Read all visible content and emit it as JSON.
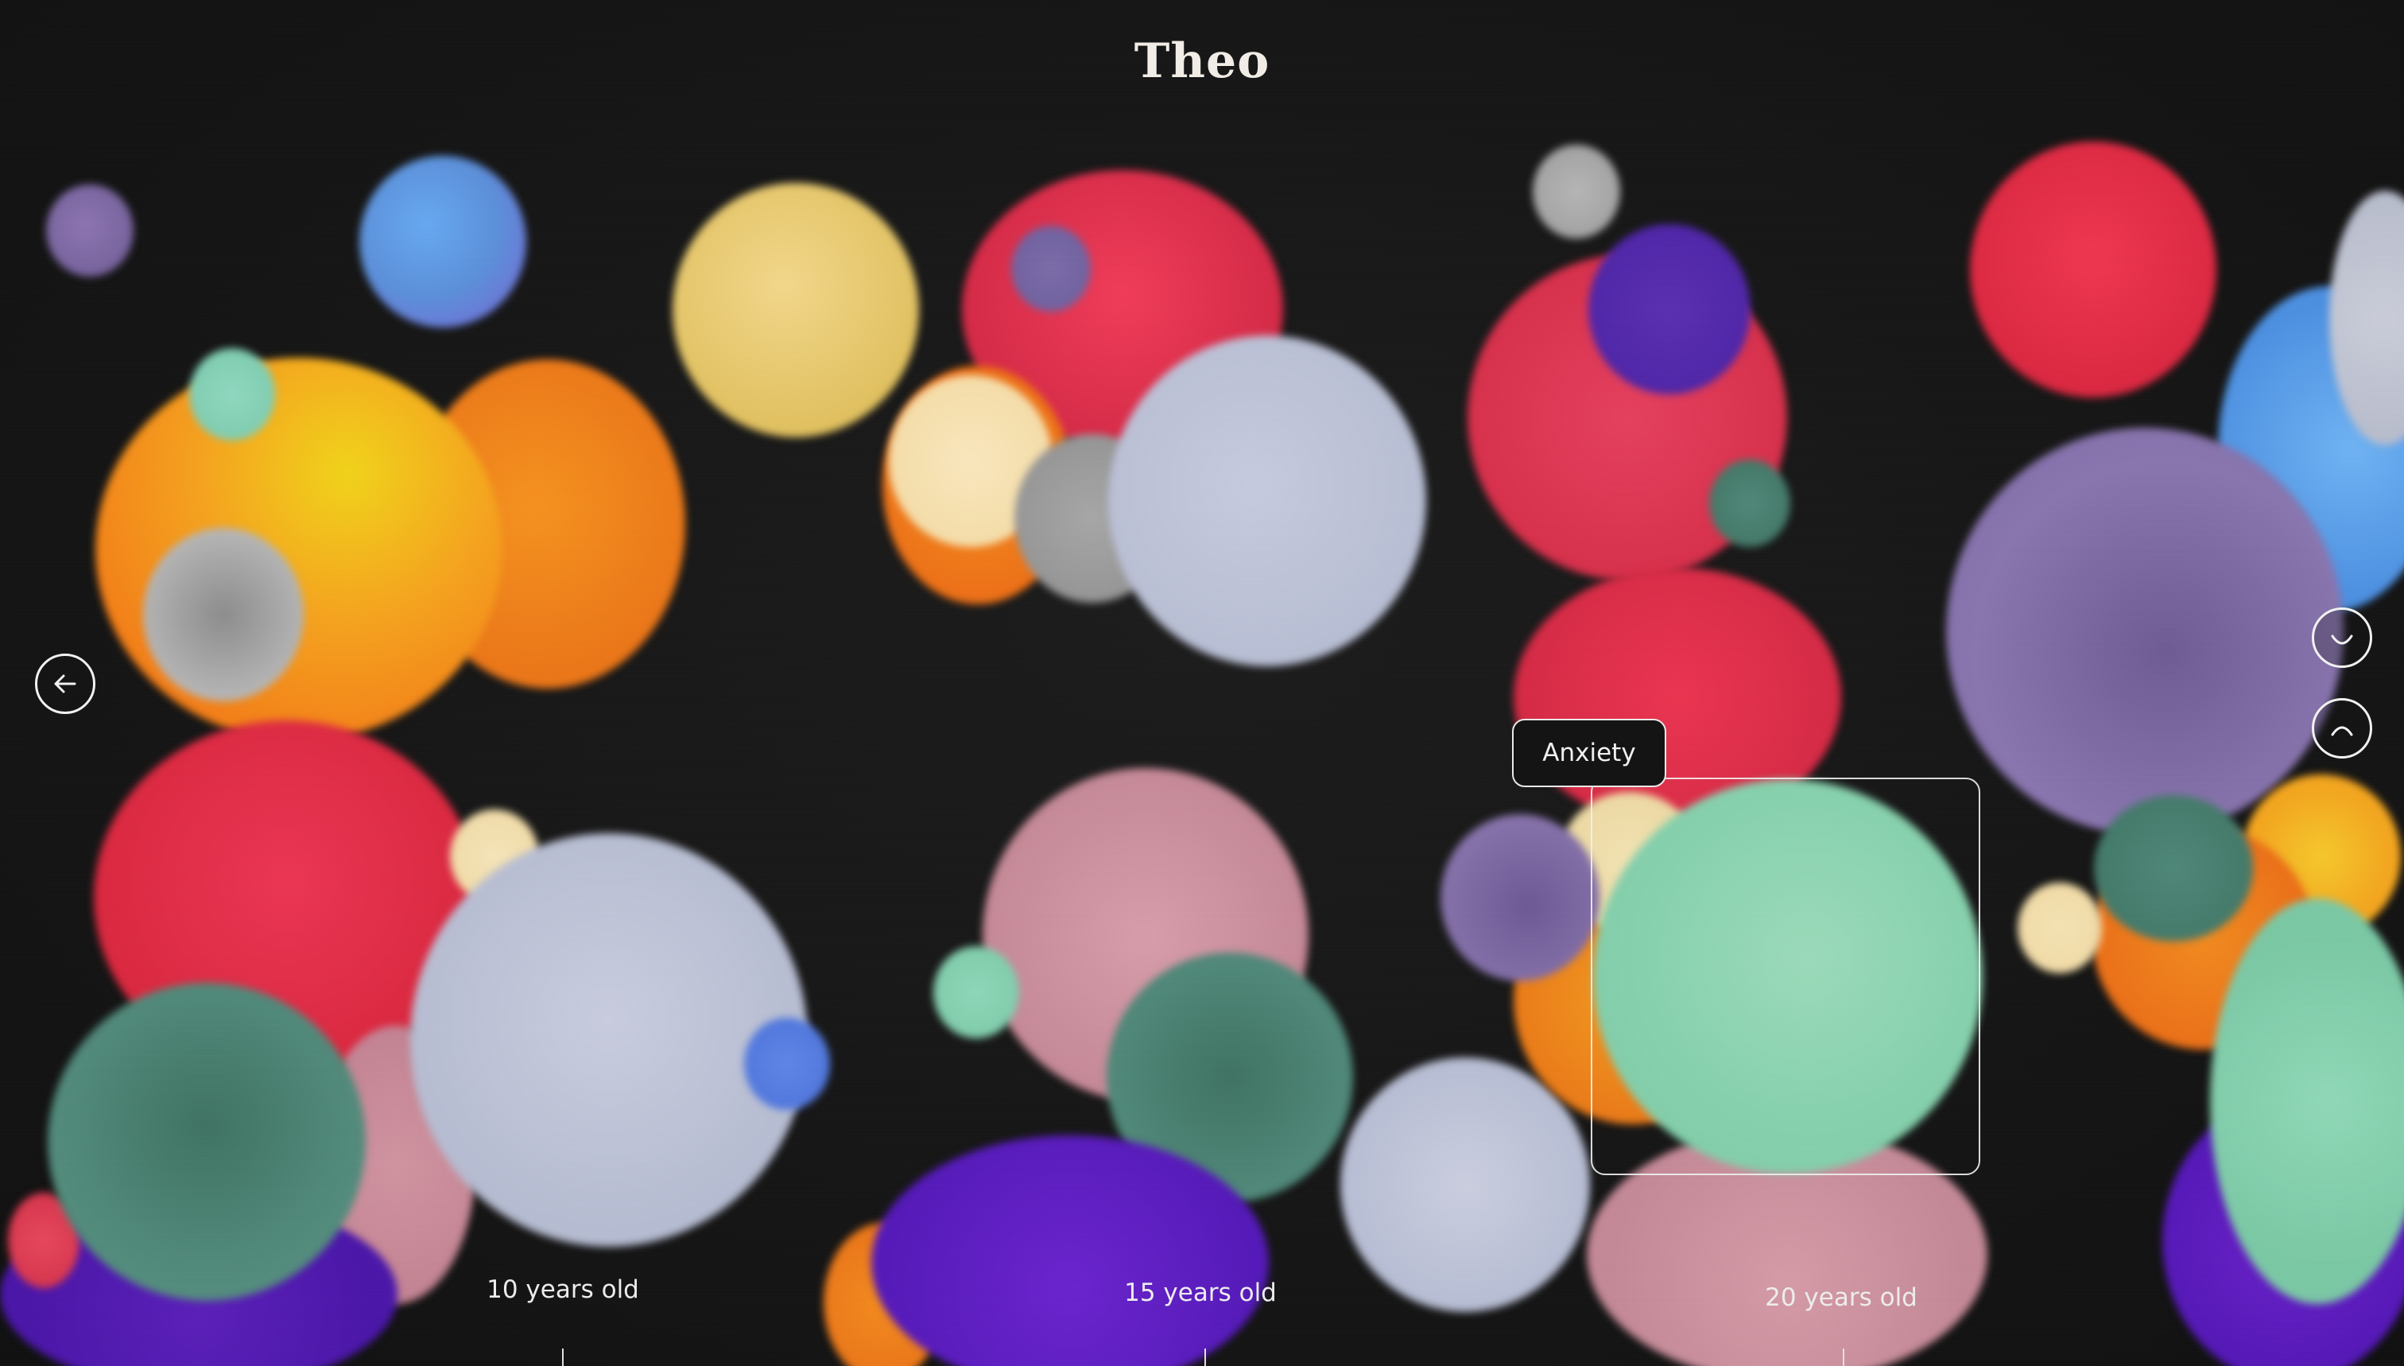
{
  "header": {
    "title": "Theo"
  },
  "navigation": {
    "back_icon": "arrow-left-icon"
  },
  "mood_controls": {
    "happy_icon": "smile-icon",
    "sad_icon": "frown-icon"
  },
  "tooltip": {
    "label": "Anxiety"
  },
  "timeline": {
    "labels": [
      "10 years old",
      "15 years old",
      "20 years old"
    ]
  },
  "colors": {
    "background": "#161616",
    "red": "#e8344f",
    "orange": "#f28a1e",
    "yellow": "#e8cc73",
    "lavender": "#c4c9dc",
    "purple": "#7e6aa8",
    "teal": "#4f8778",
    "mint": "#86d4b2",
    "pink": "#cc8e9e",
    "blue": "#5fa4ea",
    "violet": "#5a20c4",
    "cream": "#f0dfae",
    "gray": "#a9a9a9"
  }
}
